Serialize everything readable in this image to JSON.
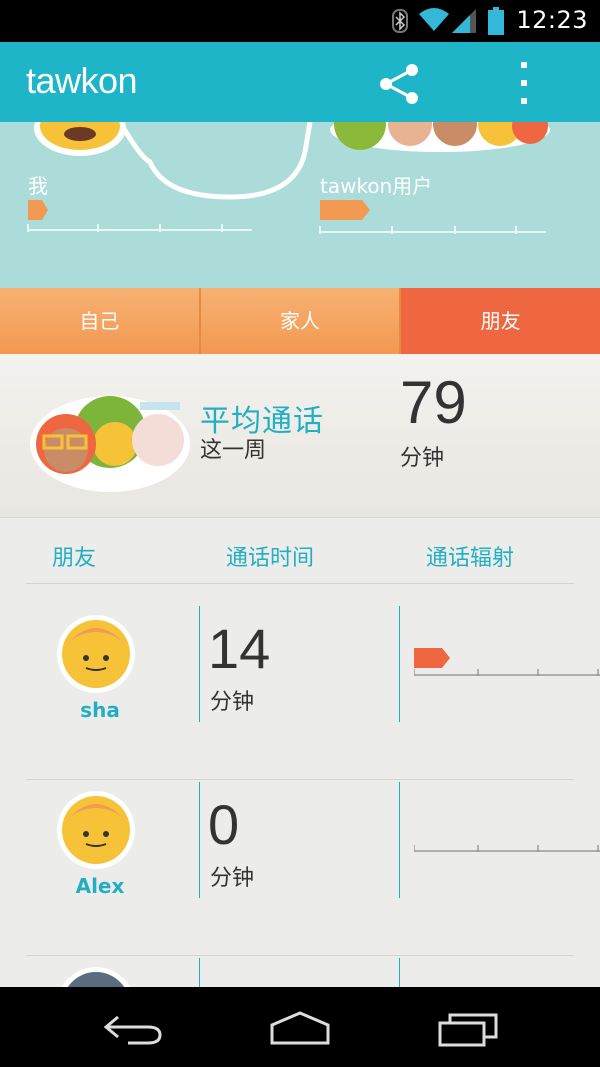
{
  "status_bar": {
    "time": "12:23",
    "icons": [
      "bluetooth-icon",
      "wifi-icon",
      "signal-icon",
      "battery-icon"
    ]
  },
  "app_bar": {
    "title": "tawkon",
    "actions": [
      "share-icon",
      "more-icon"
    ]
  },
  "comparison": {
    "me_label": "我",
    "users_label": "tawkon用户"
  },
  "tabs": [
    {
      "label": "自己",
      "active": false
    },
    {
      "label": "家人",
      "active": false
    },
    {
      "label": "朋友",
      "active": true
    }
  ],
  "summary": {
    "title": "平均通话",
    "period": "这一周",
    "value": "79",
    "unit": "分钟"
  },
  "table": {
    "headers": [
      "朋友",
      "通话时间",
      "通话辐射"
    ],
    "rows": [
      {
        "name": "sha",
        "minutes": "14",
        "unit": "分钟",
        "radiation_level": 0.15
      },
      {
        "name": "Alex",
        "minutes": "0",
        "unit": "分钟",
        "radiation_level": 0
      }
    ]
  },
  "colors": {
    "accent": "#1fb5c8",
    "tab": "#f29952",
    "tab_active": "#ef6741",
    "panel": "#abdcd9"
  },
  "nav_bar": [
    "back-icon",
    "home-icon",
    "recents-icon"
  ]
}
